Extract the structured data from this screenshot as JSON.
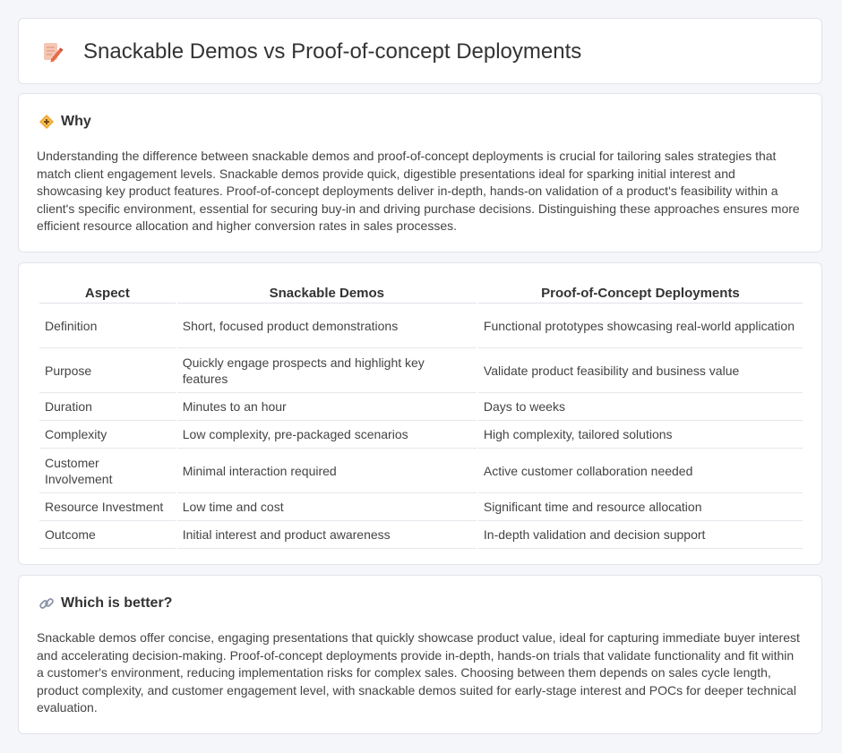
{
  "page": {
    "title": "Snackable Demos vs Proof-of-concept Deployments",
    "title_icon": "pencil-edit-icon"
  },
  "why": {
    "heading": "Why",
    "icon": "diamond-sign-icon",
    "body": "Understanding the difference between snackable demos and proof-of-concept deployments is crucial for tailoring sales strategies that match client engagement levels. Snackable demos provide quick, digestible presentations ideal for sparking initial interest and showcasing key product features. Proof-of-concept deployments deliver in-depth, hands-on validation of a product's feasibility within a client's specific environment, essential for securing buy-in and driving purchase decisions. Distinguishing these approaches ensures more efficient resource allocation and higher conversion rates in sales processes."
  },
  "comparison": {
    "headers": [
      "Aspect",
      "Snackable Demos",
      "Proof-of-Concept Deployments"
    ],
    "rows": [
      [
        "Definition",
        "Short, focused product demonstrations",
        "Functional prototypes showcasing real-world application"
      ],
      [
        "Purpose",
        "Quickly engage prospects and highlight key features",
        "Validate product feasibility and business value"
      ],
      [
        "Duration",
        "Minutes to an hour",
        "Days to weeks"
      ],
      [
        "Complexity",
        "Low complexity, pre-packaged scenarios",
        "High complexity, tailored solutions"
      ],
      [
        "Customer Involvement",
        "Minimal interaction required",
        "Active customer collaboration needed"
      ],
      [
        "Resource Investment",
        "Low time and cost",
        "Significant time and resource allocation"
      ],
      [
        "Outcome",
        "Initial interest and product awareness",
        "In-depth validation and decision support"
      ]
    ]
  },
  "better": {
    "heading": "Which is better?",
    "icon": "link-icon",
    "body": "Snackable demos offer concise, engaging presentations that quickly showcase product value, ideal for capturing immediate buyer interest and accelerating decision-making. Proof-of-concept deployments provide in-depth, hands-on trials that validate functionality and fit within a customer's environment, reducing implementation risks for complex sales. Choosing between them depends on sales cycle length, product complexity, and customer engagement level, with snackable demos suited for early-stage interest and POCs for deeper technical evaluation."
  },
  "colors": {
    "background": "#f5f6fa",
    "card": "#ffffff",
    "border": "#e1e4ea",
    "text": "#333333",
    "icon_accent": "#e8834e"
  }
}
